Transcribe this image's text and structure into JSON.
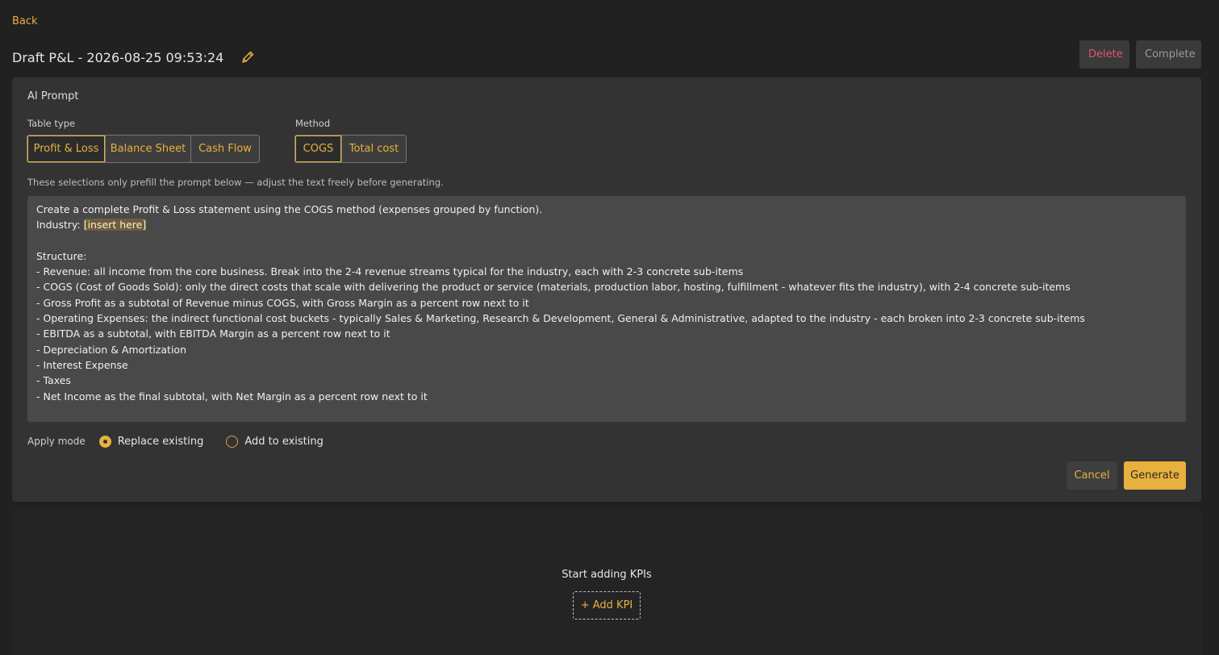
{
  "nav": {
    "back_label": "Back"
  },
  "header": {
    "title": "Draft P&L - 2026-08-25 09:53:24",
    "delete_label": "Delete",
    "complete_label": "Complete"
  },
  "ai_prompt": {
    "heading": "AI Prompt",
    "table_type": {
      "label": "Table type",
      "options": [
        "Profit & Loss",
        "Balance Sheet",
        "Cash Flow"
      ],
      "selected": "Profit & Loss"
    },
    "method": {
      "label": "Method",
      "options": [
        "COGS",
        "Total cost"
      ],
      "selected": "COGS"
    },
    "hint": "These selections only prefill the prompt below — adjust the text freely before generating.",
    "prompt_lines": [
      "Create a complete Profit & Loss statement using the COGS method (expenses grouped by function).",
      "Industry: ",
      "",
      "Structure:",
      "- Revenue: all income from the core business. Break into the 2-4 revenue streams typical for the industry, each with 2-3 concrete sub-items",
      "- COGS (Cost of Goods Sold): only the direct costs that scale with delivering the product or service (materials, production labor, hosting, fulfillment - whatever fits the industry), with 2-4 concrete sub-items",
      "- Gross Profit as a subtotal of Revenue minus COGS, with Gross Margin as a percent row next to it",
      "- Operating Expenses: the indirect functional cost buckets - typically Sales & Marketing, Research & Development, General & Administrative, adapted to the industry - each broken into 2-3 concrete sub-items",
      "- EBITDA as a subtotal, with EBITDA Margin as a percent row next to it",
      "- Depreciation & Amortization",
      "- Interest Expense",
      "- Taxes",
      "- Net Income as the final subtotal, with Net Margin as a percent row next to it"
    ],
    "industry_placeholder": "[insert here]",
    "apply_mode": {
      "label": "Apply mode",
      "options": [
        "Replace existing",
        "Add to existing"
      ],
      "selected": "Replace existing"
    },
    "cancel_label": "Cancel",
    "generate_label": "Generate"
  },
  "kpis": {
    "empty_title": "Start adding KPIs",
    "add_label": "+ Add KPI"
  },
  "colors": {
    "accent": "#e8b13d",
    "danger": "#e0566d",
    "background": "#212121",
    "panel": "#333333"
  }
}
